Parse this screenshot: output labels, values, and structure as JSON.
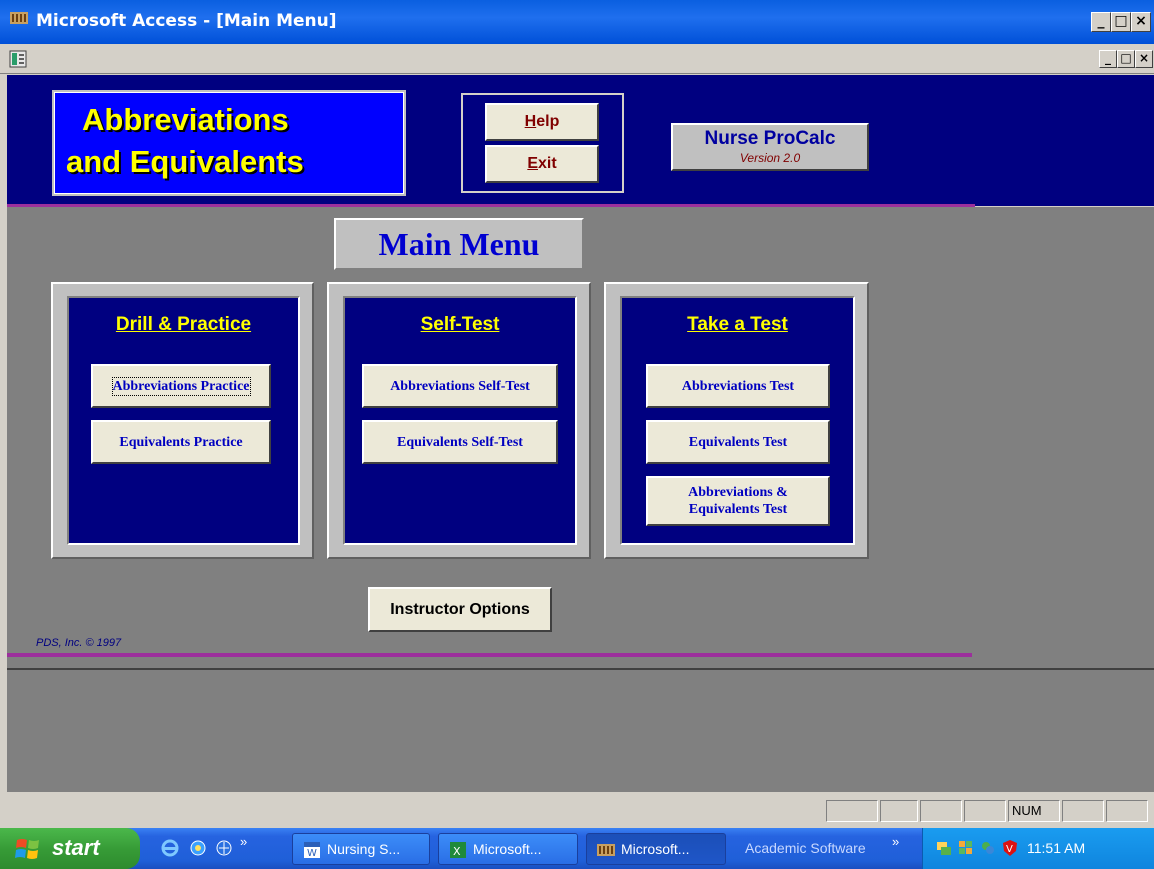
{
  "window": {
    "title": "Microsoft Access - [Main Menu]",
    "minimize": "_",
    "restore": "□",
    "close": "×",
    "mdi_minimize": "_",
    "mdi_restore": "□",
    "mdi_close": "×"
  },
  "header": {
    "title_line1": "Abbreviations",
    "title_line2": "and Equivalents",
    "help_accel": "H",
    "help_rest": "elp",
    "exit_accel": "E",
    "exit_rest": "xit",
    "product_name": "Nurse ProCalc",
    "product_version": "Version 2.0"
  },
  "main": {
    "heading": "Main Menu",
    "panels": [
      {
        "title": "Drill & Practice",
        "buttons": [
          "Abbreviations Practice",
          "Equivalents Practice"
        ]
      },
      {
        "title": "Self-Test",
        "buttons": [
          "Abbreviations Self-Test",
          "Equivalents Self-Test"
        ]
      },
      {
        "title": "Take a Test",
        "buttons": [
          "Abbreviations Test",
          "Equivalents Test",
          "Abbreviations &",
          "Equivalents Test"
        ]
      }
    ],
    "instructor_button": "Instructor Options",
    "copyright": "PDS, Inc. © 1997"
  },
  "statusbar": {
    "num": "NUM"
  },
  "taskbar": {
    "start": "start",
    "buttons": [
      "Nursing S...",
      "Microsoft...",
      "Microsoft..."
    ],
    "toolbar_label": "Academic Software",
    "clock": "11:51 AM"
  }
}
